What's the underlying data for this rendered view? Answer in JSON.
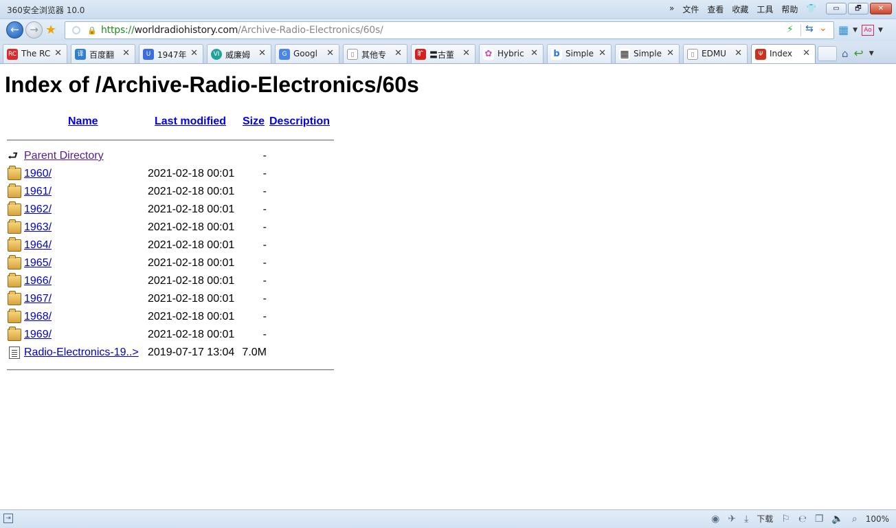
{
  "window": {
    "title": "360安全浏览器 10.0",
    "menu": [
      "文件",
      "查看",
      "收藏",
      "工具",
      "帮助"
    ],
    "menu_chevron": "»",
    "controls": {
      "minimize": "▭",
      "maximize": "🗗",
      "close": "✕"
    }
  },
  "nav": {
    "url_scheme": "https://",
    "url_host": "worldradiohistory.com",
    "url_path": "/Archive-Radio-Electronics/60s/"
  },
  "tabs": [
    {
      "label": "The RC",
      "favicon_text": "RC",
      "favicon_color": "#d92b2b"
    },
    {
      "label": "百度翻",
      "favicon_text": "译",
      "favicon_color": "#2f7fd6"
    },
    {
      "label": "1947年",
      "favicon_text": "U",
      "favicon_color": "#3a6ee0"
    },
    {
      "label": "威廉姆",
      "favicon_text": "VI",
      "favicon_color": "#22a39a"
    },
    {
      "label": "Googl",
      "favicon_text": "G",
      "favicon_color": "#4a86e8"
    },
    {
      "label": "其他专",
      "favicon_text": "▯",
      "favicon_color": "#ffffff"
    },
    {
      "label": "〓古董",
      "favicon_text": "旷",
      "favicon_color": "#d62020"
    },
    {
      "label": "Hybric",
      "favicon_text": "✿",
      "favicon_color": "#c94fb0"
    },
    {
      "label": "Simple",
      "favicon_text": "b",
      "favicon_color": "#2a7bd5"
    },
    {
      "label": "Simple",
      "favicon_text": "▦",
      "favicon_color": "#222222"
    },
    {
      "label": "EDMU",
      "favicon_text": "▯",
      "favicon_color": "#ffffff"
    },
    {
      "label": "Index",
      "favicon_text": "Ψ",
      "favicon_color": "#c8321e"
    }
  ],
  "page": {
    "title": "Index of /Archive-Radio-Electronics/60s",
    "columns": {
      "name": "Name",
      "last_modified": "Last modified",
      "size": "Size",
      "description": "Description"
    },
    "parent": {
      "name": "Parent Directory",
      "size": "-"
    },
    "entries": [
      {
        "name": "1960/",
        "date": "2021-02-18 00:01",
        "size": "-",
        "type": "folder"
      },
      {
        "name": "1961/",
        "date": "2021-02-18 00:01",
        "size": "-",
        "type": "folder"
      },
      {
        "name": "1962/",
        "date": "2021-02-18 00:01",
        "size": "-",
        "type": "folder"
      },
      {
        "name": "1963/",
        "date": "2021-02-18 00:01",
        "size": "-",
        "type": "folder"
      },
      {
        "name": "1964/",
        "date": "2021-02-18 00:01",
        "size": "-",
        "type": "folder"
      },
      {
        "name": "1965/",
        "date": "2021-02-18 00:01",
        "size": "-",
        "type": "folder"
      },
      {
        "name": "1966/",
        "date": "2021-02-18 00:01",
        "size": "-",
        "type": "folder"
      },
      {
        "name": "1967/",
        "date": "2021-02-18 00:01",
        "size": "-",
        "type": "folder"
      },
      {
        "name": "1968/",
        "date": "2021-02-18 00:01",
        "size": "-",
        "type": "folder"
      },
      {
        "name": "1969/",
        "date": "2021-02-18 00:01",
        "size": "-",
        "type": "folder"
      },
      {
        "name": "Radio-Electronics-19..>",
        "date": "2019-07-17 13:04",
        "size": "7.0M",
        "type": "file"
      }
    ]
  },
  "status": {
    "download_label": "下载",
    "zoom": "100%"
  },
  "colors": {
    "link": "#0000cc",
    "visited_link": "#551a8b",
    "url_scheme": "#1f8a1f"
  },
  "icons": {
    "back": "back-arrow-icon",
    "forward": "forward-arrow-icon",
    "favorite": "star-icon",
    "home": "home-icon",
    "undo": "undo-icon",
    "folder": "folder-icon",
    "file": "file-icon",
    "parent": "parent-directory-icon"
  }
}
